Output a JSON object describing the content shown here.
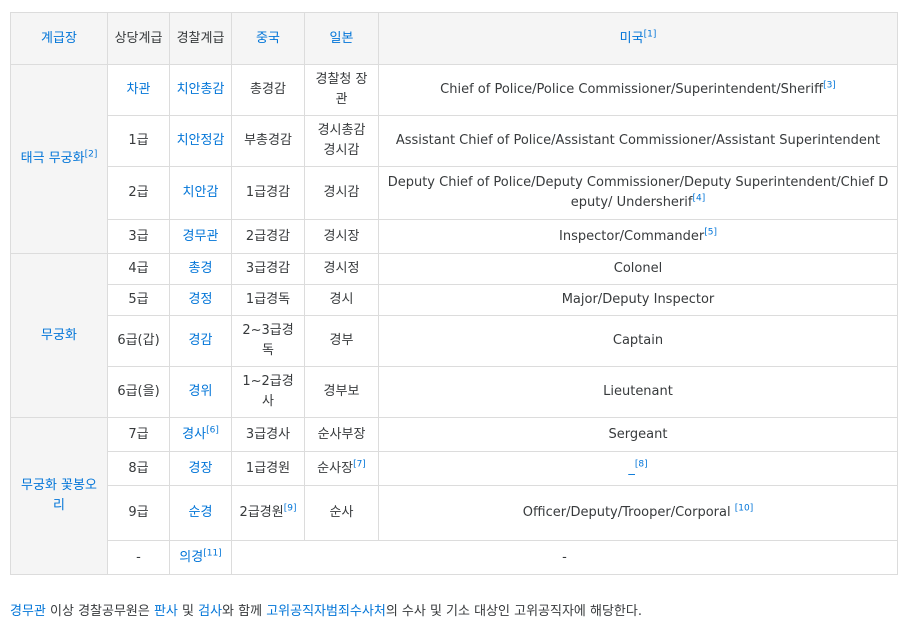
{
  "headers": {
    "insignia": "계급장",
    "equivalent": "상당계급",
    "police_rank": "경찰계급",
    "china": "중국",
    "japan": "일본",
    "usa": "미국",
    "usa_ref": "[1]"
  },
  "groups": {
    "taeguk": {
      "label": "태극 무궁화",
      "ref": "[2]"
    },
    "mugunghwa": {
      "label": "무궁화"
    },
    "bud": {
      "label": "무궁화 꽃봉오리"
    }
  },
  "rows": [
    {
      "grade": "차관",
      "rank": "치안총감",
      "rank_ref": "",
      "china": "총경감",
      "china_ref": "",
      "japan": "경찰청 장관",
      "japan_ref": "",
      "usa": "Chief of Police/Police Commissioner/Superintendent/Sheriff",
      "usa_ref": "[3]"
    },
    {
      "grade": "1급",
      "rank": "치안정감",
      "rank_ref": "",
      "china": "부총경감",
      "china_ref": "",
      "japan": "경시총감 경시감",
      "japan_ref": "",
      "usa": "Assistant Chief of Police/Assistant Commissioner/Assistant Superintendent",
      "usa_ref": ""
    },
    {
      "grade": "2급",
      "rank": "치안감",
      "rank_ref": "",
      "china": "1급경감",
      "china_ref": "",
      "japan": "경시감",
      "japan_ref": "",
      "usa": "Deputy Chief of Police/Deputy Commissioner/Deputy Superintendent/Chief Deputy/ Undersherif",
      "usa_ref": "[4]"
    },
    {
      "grade": "3급",
      "rank": "경무관",
      "rank_ref": "",
      "china": "2급경감",
      "china_ref": "",
      "japan": "경시장",
      "japan_ref": "",
      "usa": "Inspector/Commander",
      "usa_ref": "[5]"
    },
    {
      "grade": "4급",
      "rank": "총경",
      "rank_ref": "",
      "china": "3급경감",
      "china_ref": "",
      "japan": "경시정",
      "japan_ref": "",
      "usa": "Colonel",
      "usa_ref": ""
    },
    {
      "grade": "5급",
      "rank": "경정",
      "rank_ref": "",
      "china": "1급경독",
      "china_ref": "",
      "japan": "경시",
      "japan_ref": "",
      "usa": "Major/Deputy Inspector",
      "usa_ref": ""
    },
    {
      "grade": "6급(갑)",
      "rank": "경감",
      "rank_ref": "",
      "china": "2~3급경독",
      "china_ref": "",
      "japan": "경부",
      "japan_ref": "",
      "usa": "Captain",
      "usa_ref": ""
    },
    {
      "grade": "6급(을)",
      "rank": "경위",
      "rank_ref": "",
      "china": "1~2급경사",
      "china_ref": "",
      "japan": "경부보",
      "japan_ref": "",
      "usa": "Lieutenant",
      "usa_ref": ""
    },
    {
      "grade": "7급",
      "rank": "경사",
      "rank_ref": "[6]",
      "china": "3급경사",
      "china_ref": "",
      "japan": "순사부장",
      "japan_ref": "",
      "usa": "Sergeant",
      "usa_ref": ""
    },
    {
      "grade": "8급",
      "rank": "경장",
      "rank_ref": "",
      "china": "1급경원",
      "china_ref": "",
      "japan": "순사장",
      "japan_ref": "[7]",
      "usa": "_",
      "usa_ref": "[8]"
    },
    {
      "grade": "9급",
      "rank": "순경",
      "rank_ref": "",
      "china": "2급경원",
      "china_ref": "[9]",
      "japan": "순사",
      "japan_ref": "",
      "usa": "Officer/Deputy/Trooper/Corporal ",
      "usa_ref": "[10]"
    },
    {
      "grade": "-",
      "rank": "의경",
      "rank_ref": "[11]",
      "other": "-"
    }
  ],
  "note": {
    "link1": "경무관",
    "text1": " 이상 경찰공무원은 ",
    "link2": "판사",
    "text2": " 및 ",
    "link3": "검사",
    "text3": "와 함께 ",
    "link4": "고위공직자범죄수사처",
    "text4": "의 수사 및 기소 대상인 고위공직자에 해당한다."
  },
  "colors": {
    "link": "#0275d8",
    "header_bg": "#f5f5f5",
    "border": "#dcdcdc",
    "text": "#373a3c"
  }
}
